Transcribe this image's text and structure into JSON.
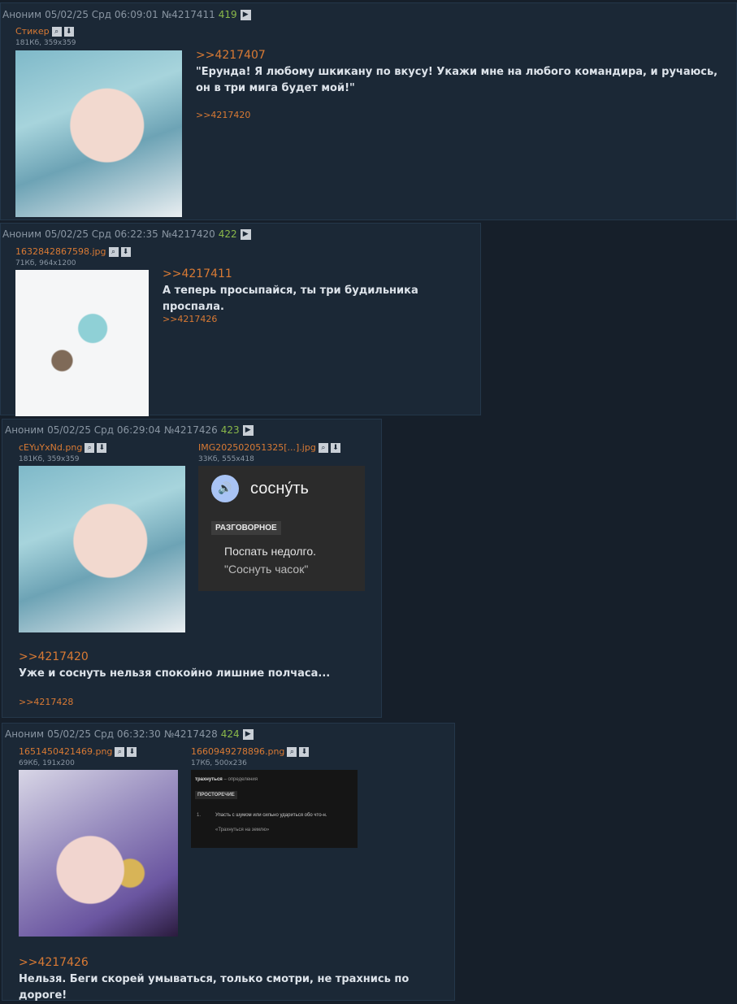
{
  "posts": [
    {
      "author": "Аноним",
      "date": "05/02/25 Срд 06:09:01",
      "number": "№4217411",
      "count": "419",
      "files": [
        {
          "name": "Стикер",
          "meta": "181Кб, 359x359"
        }
      ],
      "reply_to": ">>4217407",
      "text": "\"Ерунда! Я любому шкикану по вкусу! Укажи мне на любого командира, и ручаюсь, он в три мига будет мой!\"",
      "backlink": ">>4217420"
    },
    {
      "author": "Аноним",
      "date": "05/02/25 Срд 06:22:35",
      "number": "№4217420",
      "count": "422",
      "files": [
        {
          "name": "1632842867598.jpg",
          "meta": "71Кб, 964x1200"
        }
      ],
      "reply_to": ">>4217411",
      "text": "А теперь просыпайся, ты три будильника проспала.",
      "backlink": ">>4217426"
    },
    {
      "author": "Аноним",
      "date": "05/02/25 Срд 06:29:04",
      "number": "№4217426",
      "count": "423",
      "files": [
        {
          "name": "cEYuYxNd.png",
          "meta": "181Кб, 359x359"
        },
        {
          "name": "IMG202502051325[...].jpg",
          "meta": "33Кб, 555x418",
          "card": {
            "word": "сосну́ть",
            "tag": "РАЗГОВОРНОЕ",
            "def": "Поспать недолго.",
            "example": "\"Соснуть часок\""
          }
        }
      ],
      "reply_to": ">>4217420",
      "text": "Уже и соснуть нельзя спокойно лишние полчаса...",
      "backlink": ">>4217428"
    },
    {
      "author": "Аноним",
      "date": "05/02/25 Срд 06:32:30",
      "number": "№4217428",
      "count": "424",
      "files": [
        {
          "name": "1651450421469.png",
          "meta": "69Кб, 191x200"
        },
        {
          "name": "1660949278896.png",
          "meta": "17Кб, 500x236",
          "card": {
            "word": "трахнуться",
            "word_suffix": " – определения",
            "tag": "ПРОСТОРЕЧИЕ",
            "num": "1.",
            "def": "Упасть с шумом или сильно удариться обо что-н.",
            "example": "«Трахнуться на землю»"
          }
        }
      ],
      "reply_to": ">>4217426",
      "text": "Нельзя. Беги скорей умываться, только смотри, не трахнись по дороге!"
    }
  ],
  "icons": {
    "play": "play-icon",
    "search": "search-icon",
    "download": "download-icon",
    "speaker": "speaker-icon"
  }
}
